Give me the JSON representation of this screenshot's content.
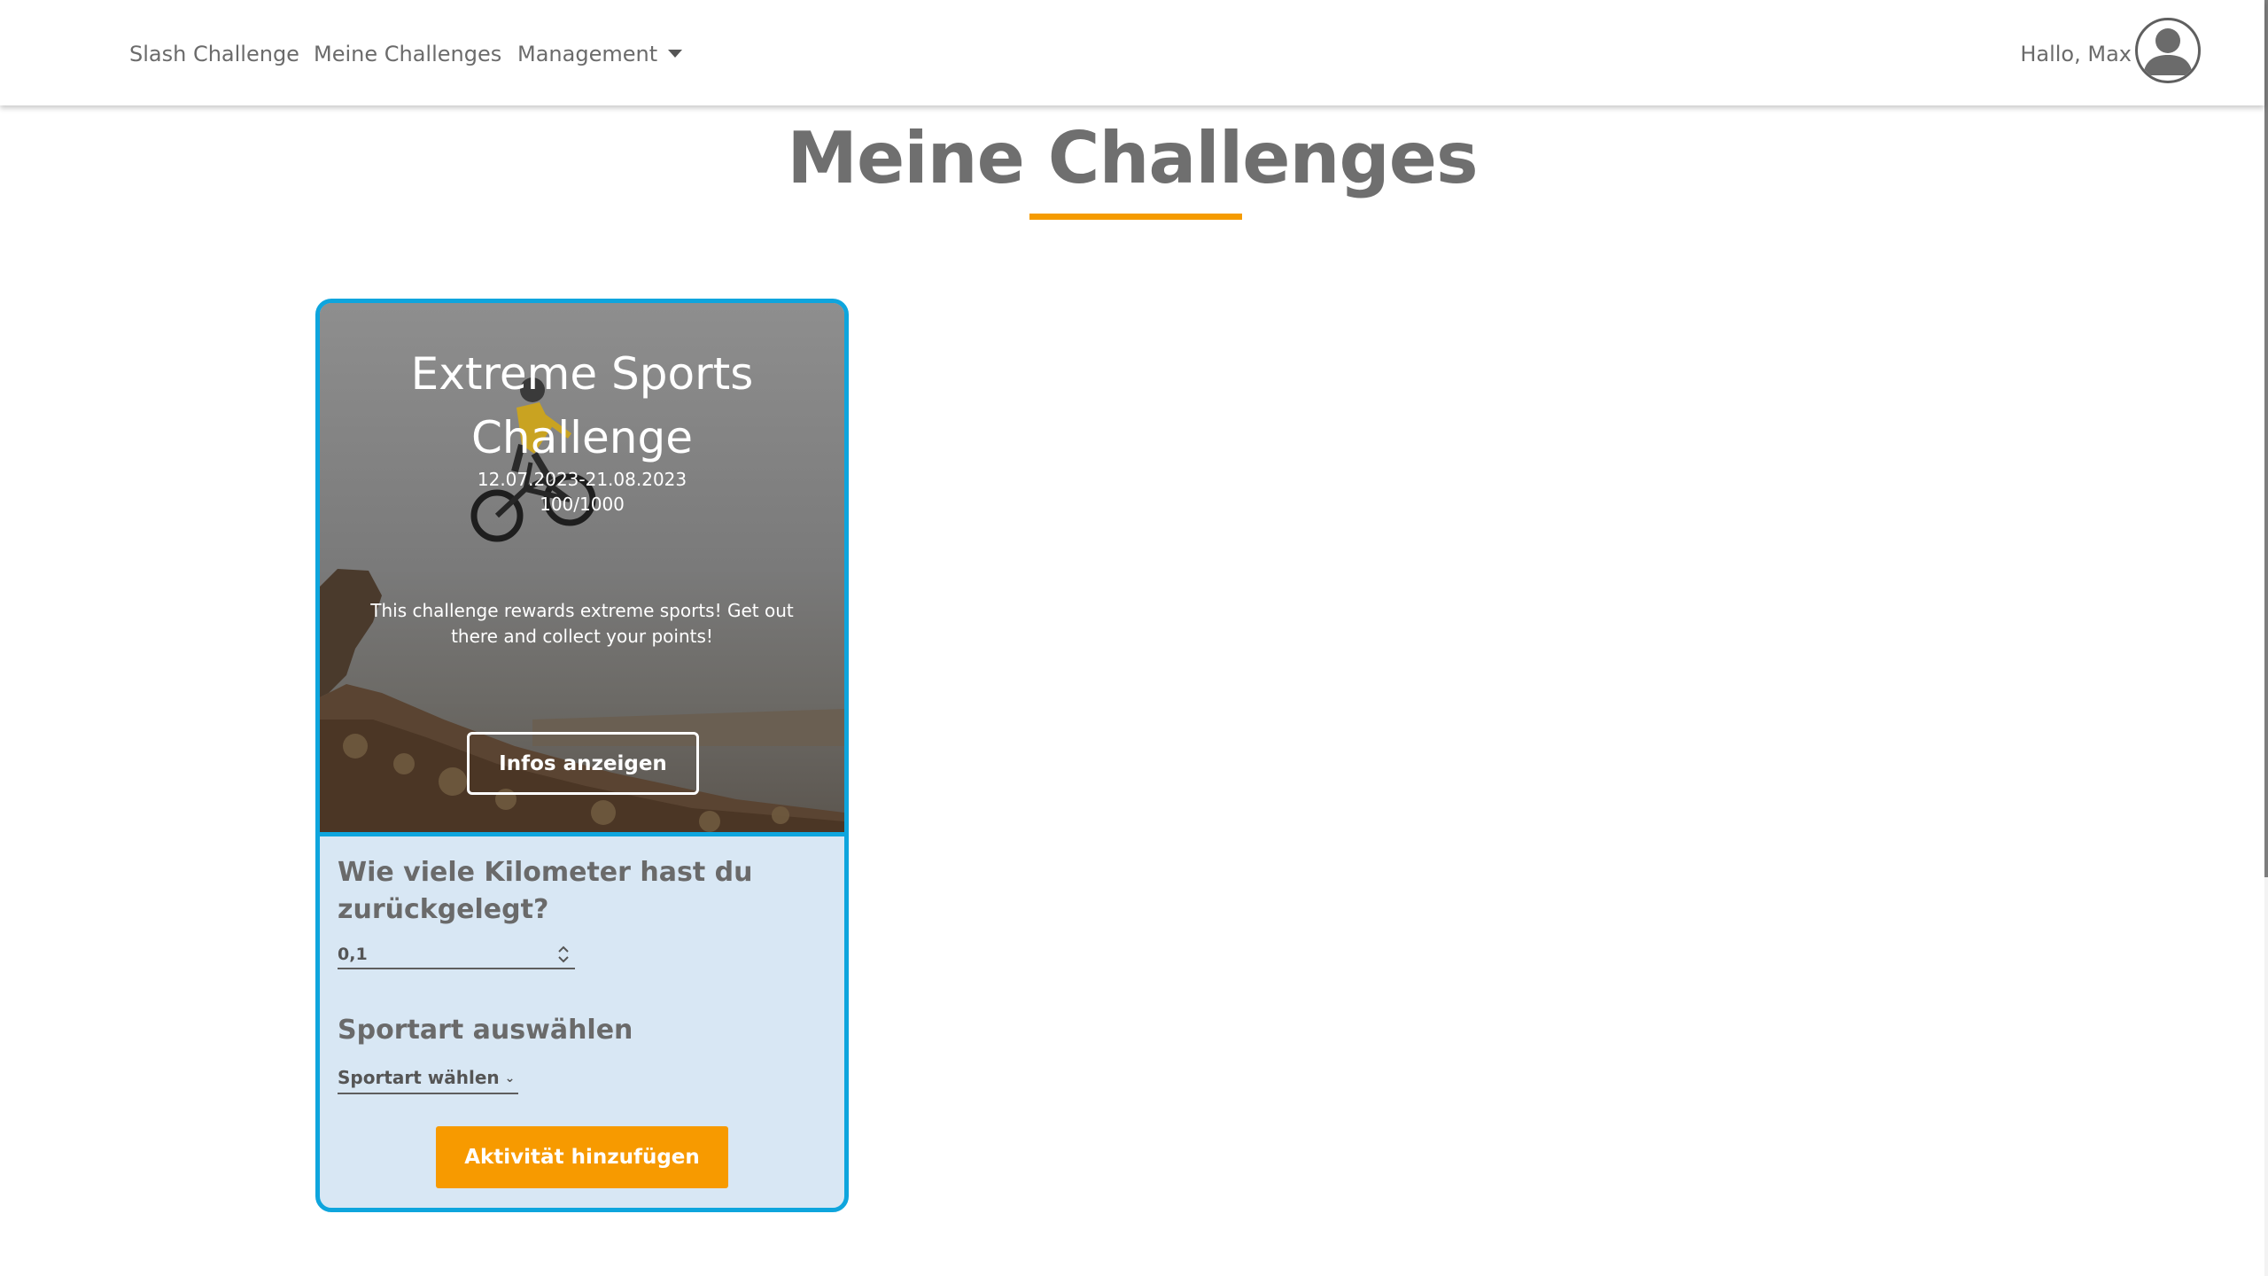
{
  "nav": {
    "items": [
      {
        "label": "Slash Challenge"
      },
      {
        "label": "Meine Challenges"
      },
      {
        "label": "Management"
      }
    ],
    "greeting": "Hallo, Max"
  },
  "page": {
    "title": "Meine Challenges"
  },
  "card": {
    "title": "Extreme Sports Challenge",
    "dates": "12.07.2023-21.08.2023",
    "points": "100/1000",
    "description": "This challenge rewards extreme sports! Get out there and collect your points!",
    "info_button": "Infos anzeigen",
    "km_question": "Wie viele Kilometer hast du zurückgelegt?",
    "km_value": "0,1",
    "sport_heading": "Sportart auswählen",
    "sport_select": "Sportart wählen",
    "add_button": "Aktivität hinzufügen"
  },
  "colors": {
    "accent_orange": "#f59b00",
    "card_border": "#0ea5dd",
    "card_form_bg": "#d8e7f4"
  },
  "icons": [
    "user-avatar-icon",
    "caret-down-icon",
    "spinner-icon",
    "chevron-down-icon"
  ]
}
